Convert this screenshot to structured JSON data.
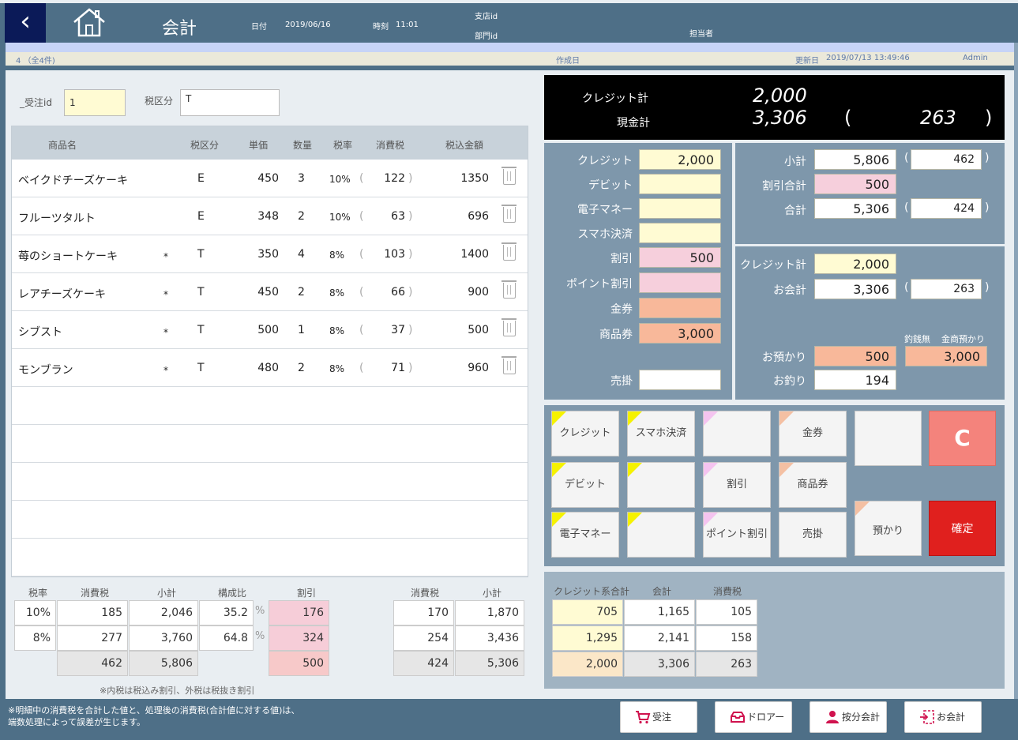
{
  "header": {
    "title": "会計",
    "date_label": "日付",
    "date": "2019/06/16",
    "time_label": "時刻",
    "time": "11:01",
    "branch_label": "支店id",
    "dept_label": "部門id",
    "staff_label": "担当者"
  },
  "infobar": {
    "count": "4 （全4件)",
    "created_label": "作成日",
    "updated_label": "更新日",
    "updated": "2019/07/13 13:49:46",
    "user": "Admin"
  },
  "order": {
    "id_label": "_受注id",
    "id_value": "1",
    "tax_label": "税区分",
    "tax_value": "T"
  },
  "table": {
    "headers": [
      "商品名",
      "税区分",
      "単価",
      "数量",
      "税率",
      "消費税",
      "税込金額"
    ],
    "rows": [
      {
        "name": "ベイクドチーズケーキ",
        "star": "",
        "tk": "E",
        "price": "450",
        "qty": "3",
        "rate": "10%",
        "tax": "122",
        "total": "1350"
      },
      {
        "name": "フルーツタルト",
        "star": "",
        "tk": "E",
        "price": "348",
        "qty": "2",
        "rate": "10%",
        "tax": "63",
        "total": "696"
      },
      {
        "name": "苺のショートケーキ",
        "star": "*",
        "tk": "T",
        "price": "350",
        "qty": "4",
        "rate": "8%",
        "tax": "103",
        "total": "1400"
      },
      {
        "name": "レアチーズケーキ",
        "star": "*",
        "tk": "T",
        "price": "450",
        "qty": "2",
        "rate": "8%",
        "tax": "66",
        "total": "900"
      },
      {
        "name": "シブスト",
        "star": "*",
        "tk": "T",
        "price": "500",
        "qty": "1",
        "rate": "8%",
        "tax": "37",
        "total": "500"
      },
      {
        "name": "モンブラン",
        "star": "*",
        "tk": "T",
        "price": "480",
        "qty": "2",
        "rate": "8%",
        "tax": "71",
        "total": "960"
      }
    ],
    "lparen": "(",
    "rparen": ")"
  },
  "summary": {
    "headers": [
      "税率",
      "消費税",
      "小計",
      "構成比",
      "割引",
      "消費税",
      "小計"
    ],
    "r1": [
      "10%",
      "185",
      "2,046",
      "35.2",
      "176",
      "170",
      "1,870"
    ],
    "r2": [
      "8%",
      "277",
      "3,760",
      "64.8",
      "324",
      "254",
      "3,436"
    ],
    "tot": [
      "462",
      "5,806",
      "500",
      "424",
      "5,306"
    ],
    "pct": "%",
    "note": "※内税は税込み割引、外税は税抜き割引"
  },
  "black": {
    "credit_label": "クレジット計",
    "credit": "2,000",
    "cash_label": "現金計",
    "cash": "3,306",
    "lp": "(",
    "tax": "263",
    "rp": ")"
  },
  "pay": {
    "labels": [
      "クレジット",
      "デビット",
      "電子マネー",
      "スマホ決済",
      "割引",
      "ポイント割引",
      "金券",
      "商品券",
      "売掛"
    ],
    "values": [
      "2,000",
      "",
      "",
      "",
      "500",
      "",
      "",
      "3,000",
      ""
    ],
    "subtotal_label": "小計",
    "subtotal": "5,806",
    "subtotal_tax": "462",
    "disc_label": "割引合計",
    "disc": "500",
    "total_label": "合計",
    "total": "5,306",
    "total_tax": "424",
    "credit_label": "クレジット計",
    "credit": "2,000",
    "bill_label": "お会計",
    "bill": "3,306",
    "bill_tax": "263",
    "nochange_label": "釣銭無",
    "gift_dep_label": "金商預かり",
    "deposit_label": "お預かり",
    "deposit": "500",
    "gift_dep": "3,000",
    "change_label": "お釣り",
    "change": "194",
    "lp": "(",
    "rp": ")"
  },
  "keys": {
    "k1": "クレジット",
    "k2": "スマホ決済",
    "k3": "",
    "k4": "金券",
    "k5": "デビット",
    "k6": "",
    "k7": "割引",
    "k8": "商品券",
    "k9": "電子マネー",
    "k10": "",
    "k11": "ポイント割引",
    "k12": "売掛",
    "blank": "",
    "dep": "預かり",
    "clear": "C",
    "ok": "確定"
  },
  "credit_sum": {
    "headers": [
      "クレジット系合計",
      "会計",
      "消費税"
    ],
    "r1": [
      "705",
      "1,165",
      "105"
    ],
    "r2": [
      "1,295",
      "2,141",
      "158"
    ],
    "r3": [
      "2,000",
      "3,306",
      "263"
    ]
  },
  "footer": {
    "note1": "※明細中の消費税を合計した値と、処理後の消費税(合計値に対する値)は、",
    "note2": "端数処理によって誤差が生じます。",
    "b1": "受注",
    "b2": "ドロアー",
    "b3": "按分会計",
    "b4": "お会計"
  }
}
